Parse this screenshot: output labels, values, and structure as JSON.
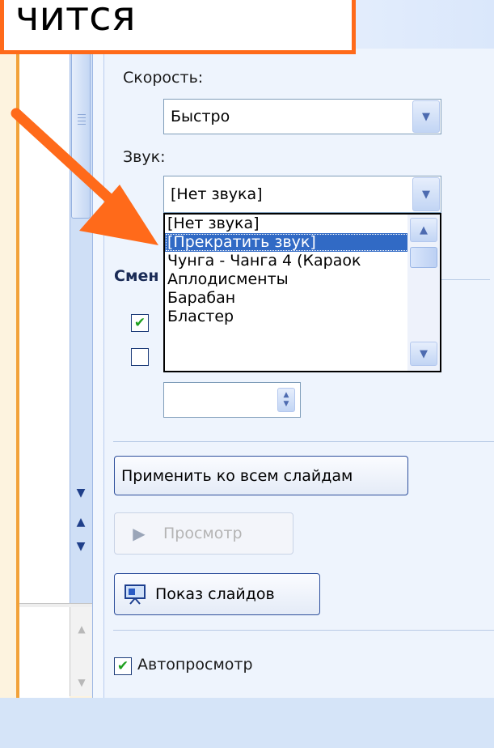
{
  "callout": {
    "text": "чится"
  },
  "pane": {
    "speed_label": "Скорость:",
    "speed_value": "Быстро",
    "sound_label": "Звук:",
    "sound_value": "[Нет звука]",
    "sound_options": [
      "[Нет звука]",
      "[Прекратить звук]",
      "Чунга - Чанга 4 (Караок",
      "Аплодисменты",
      "Барабан",
      "Бластер"
    ],
    "sound_selected_index": 1,
    "change_section_label": "Смен",
    "checkbox1_checked": true,
    "checkbox2_checked": false,
    "apply_all_button": "Применить ко всем слайдам",
    "preview_button": "Просмотр",
    "slideshow_button": "Показ слайдов",
    "autopreview_label": "Автопросмотр",
    "autopreview_checked": true
  },
  "colors": {
    "accent_orange": "#ff6a1a",
    "selection_blue": "#316ac5",
    "pane_blue": "#dae7fb"
  }
}
